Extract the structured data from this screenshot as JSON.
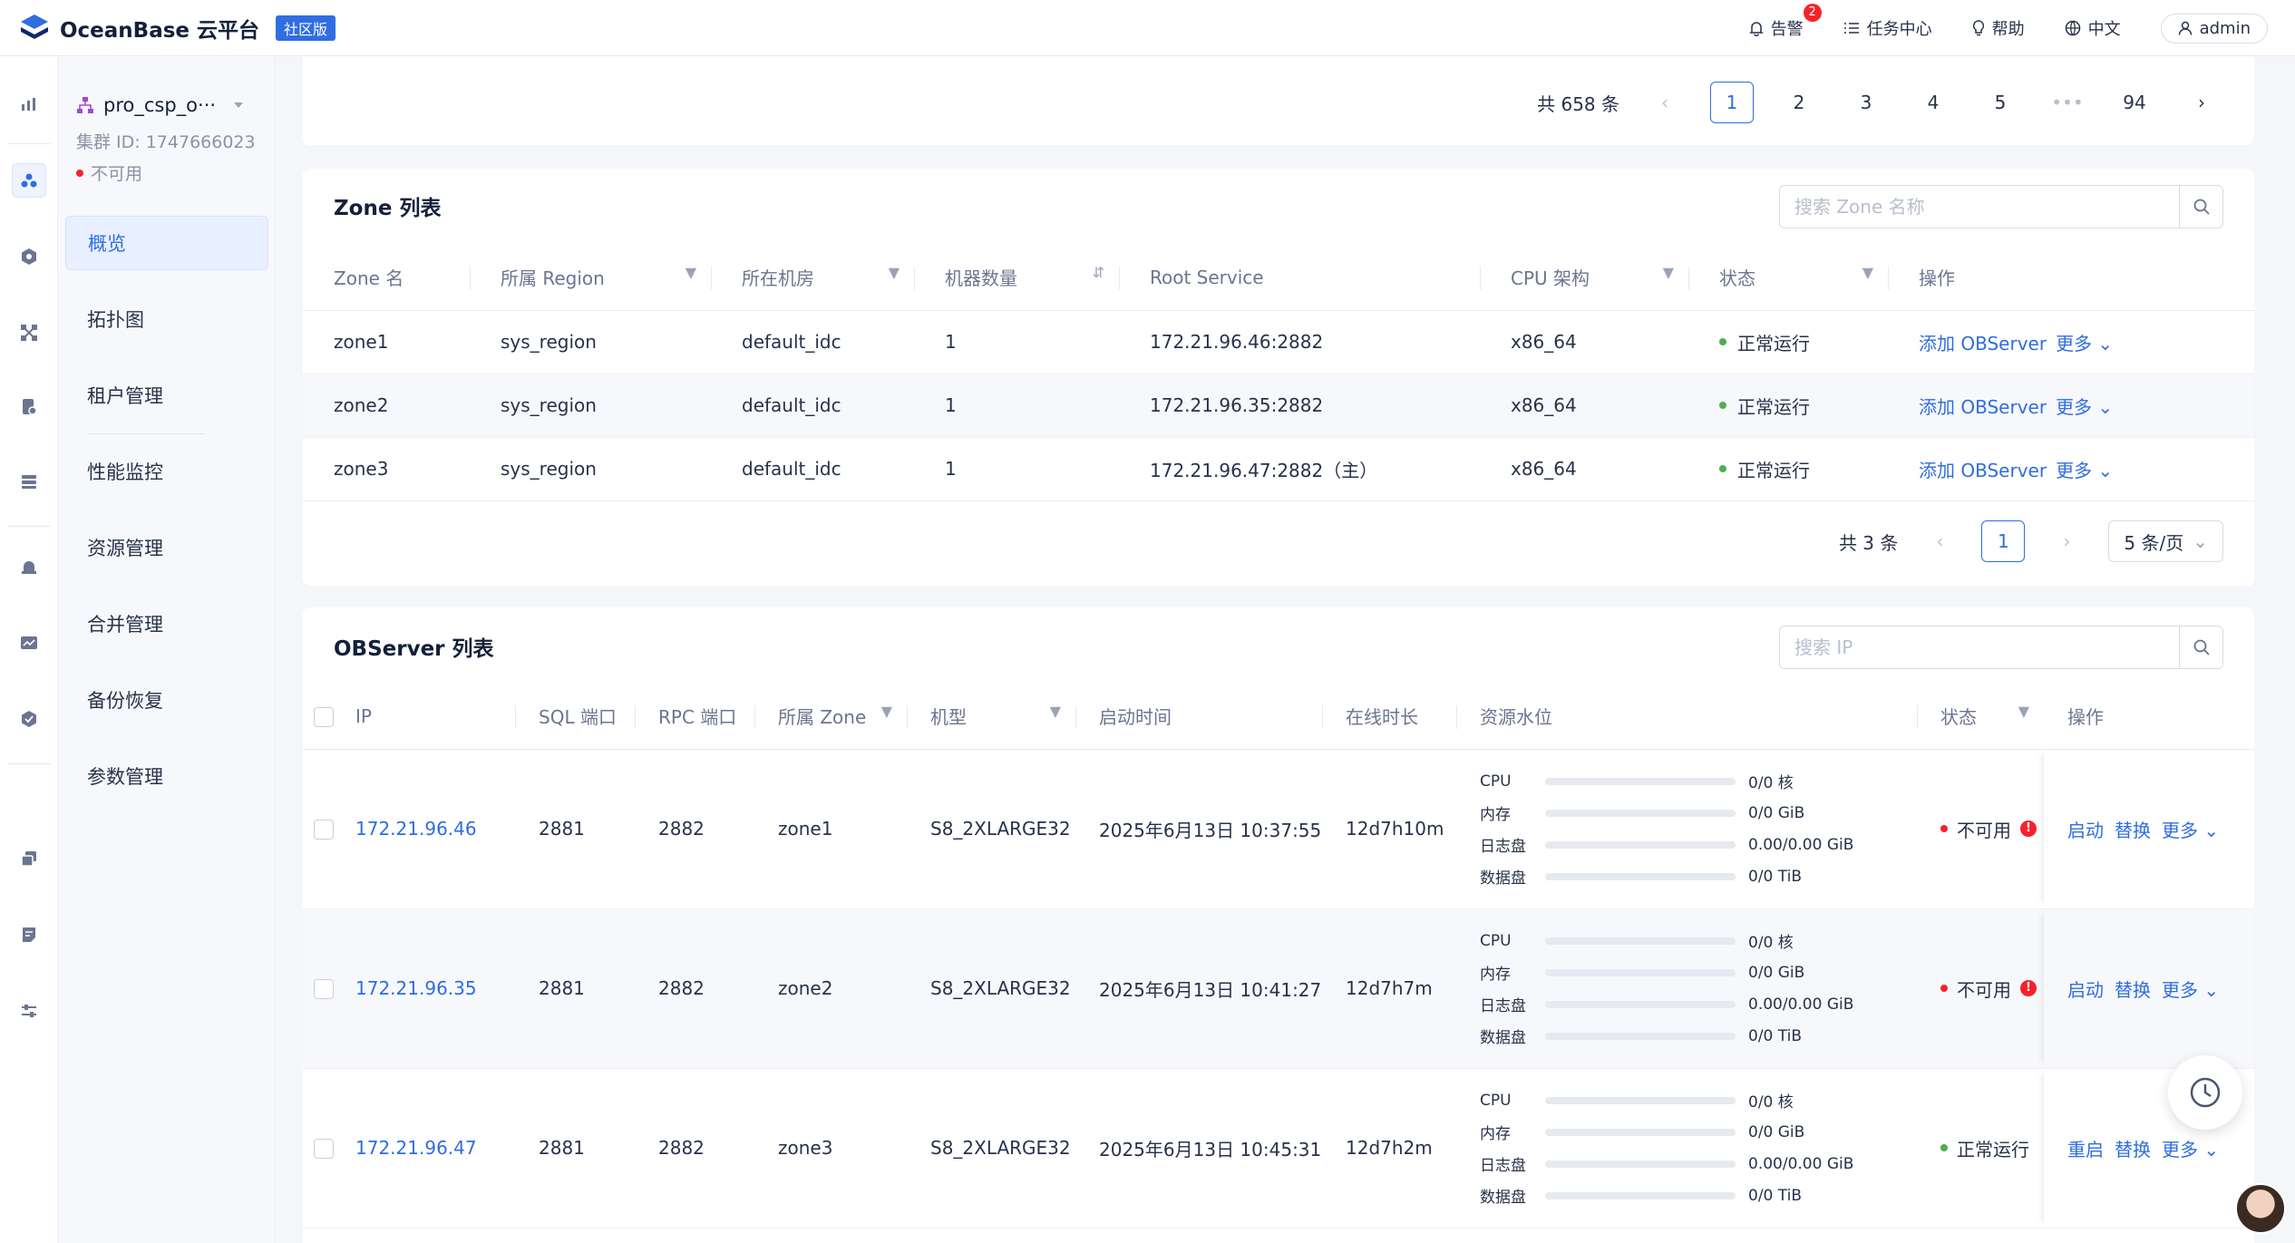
{
  "header": {
    "logo_text": "OceanBase 云平台",
    "edition": "社区版",
    "alerts_label": "告警",
    "alerts_count": "2",
    "tasks_label": "任务中心",
    "help_label": "帮助",
    "lang_label": "中文",
    "user_label": "admin"
  },
  "cluster": {
    "name": "pro_csp_o···",
    "id_text": "集群 ID: 1747666023",
    "status": "不可用"
  },
  "nav": {
    "items": [
      {
        "label": "概览",
        "active": true
      },
      {
        "label": "拓扑图"
      },
      {
        "label": "租户管理"
      },
      {
        "label": "性能监控"
      },
      {
        "label": "资源管理"
      },
      {
        "label": "合并管理"
      },
      {
        "label": "备份恢复"
      },
      {
        "label": "参数管理"
      }
    ]
  },
  "top_pager": {
    "total": "共 658 条",
    "pages": [
      "1",
      "2",
      "3",
      "4",
      "5",
      "•••",
      "94"
    ],
    "current": "1"
  },
  "zone_section": {
    "title": "Zone 列表",
    "search_placeholder": "搜索 Zone 名称",
    "columns": [
      "Zone 名",
      "所属 Region",
      "所在机房",
      "机器数量",
      "Root Service",
      "CPU 架构",
      "状态",
      "操作"
    ],
    "rows": [
      {
        "zone": "zone1",
        "region": "sys_region",
        "idc": "default_idc",
        "count": "1",
        "root": "172.21.96.46:2882",
        "cpu": "x86_64",
        "status": "正常运行",
        "action": "添加 OBServer",
        "more": "更多"
      },
      {
        "zone": "zone2",
        "region": "sys_region",
        "idc": "default_idc",
        "count": "1",
        "root": "172.21.96.35:2882",
        "cpu": "x86_64",
        "status": "正常运行",
        "action": "添加 OBServer",
        "more": "更多"
      },
      {
        "zone": "zone3",
        "region": "sys_region",
        "idc": "default_idc",
        "count": "1",
        "root": "172.21.96.47:2882（主）",
        "cpu": "x86_64",
        "status": "正常运行",
        "action": "添加 OBServer",
        "more": "更多"
      }
    ],
    "pager": {
      "total": "共 3 条",
      "current": "1",
      "page_size": "5 条/页"
    }
  },
  "observer_section": {
    "title": "OBServer 列表",
    "search_placeholder": "搜索 IP",
    "columns": [
      "IP",
      "SQL 端口",
      "RPC 端口",
      "所属 Zone",
      "机型",
      "启动时间",
      "在线时长",
      "资源水位",
      "状态",
      "操作"
    ],
    "resource_labels": [
      "CPU",
      "内存",
      "日志盘",
      "数据盘"
    ],
    "rows": [
      {
        "ip": "172.21.96.46",
        "sql_port": "2881",
        "rpc_port": "2882",
        "zone": "zone1",
        "model": "S8_2XLARGE32",
        "start_time": "2025年6月13日 10:37:55",
        "uptime": "12d7h10m",
        "resources": [
          {
            "value": "0/0 核",
            "fraction": 0
          },
          {
            "value": "0/0 GiB",
            "fraction": 0
          },
          {
            "value": "0.00/0.00 GiB",
            "fraction": 0
          },
          {
            "value": "0/0 TiB",
            "fraction": 0
          }
        ],
        "status": "不可用",
        "status_color": "#f5222d",
        "error": "!",
        "actions": [
          "启动",
          "替换",
          "更多"
        ]
      },
      {
        "ip": "172.21.96.35",
        "sql_port": "2881",
        "rpc_port": "2882",
        "zone": "zone2",
        "model": "S8_2XLARGE32",
        "start_time": "2025年6月13日 10:41:27",
        "uptime": "12d7h7m",
        "resources": [
          {
            "value": "0/0 核",
            "fraction": 0
          },
          {
            "value": "0/0 GiB",
            "fraction": 0
          },
          {
            "value": "0.00/0.00 GiB",
            "fraction": 0
          },
          {
            "value": "0/0 TiB",
            "fraction": 0
          }
        ],
        "status": "不可用",
        "status_color": "#f5222d",
        "error": "!",
        "actions": [
          "启动",
          "替换",
          "更多"
        ]
      },
      {
        "ip": "172.21.96.47",
        "sql_port": "2881",
        "rpc_port": "2882",
        "zone": "zone3",
        "model": "S8_2XLARGE32",
        "start_time": "2025年6月13日 10:45:31",
        "uptime": "12d7h2m",
        "resources": [
          {
            "value": "0/0 核",
            "fraction": 0
          },
          {
            "value": "0/0 GiB",
            "fraction": 0
          },
          {
            "value": "0.00/0.00 GiB",
            "fraction": 0
          },
          {
            "value": "0/0 TiB",
            "fraction": 0
          }
        ],
        "status": "正常运行",
        "status_color": "#4caf50",
        "error": "",
        "actions": [
          "重启",
          "替换",
          "更多"
        ]
      }
    ]
  },
  "colors": {
    "accent": "#2f6de1",
    "danger": "#f5222d",
    "success": "#4caf50"
  }
}
